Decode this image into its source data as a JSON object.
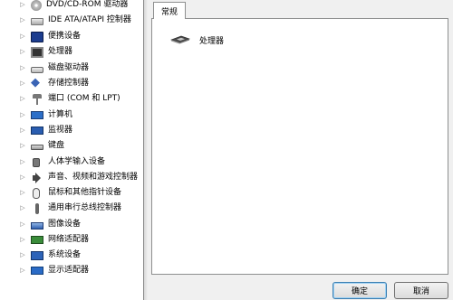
{
  "device_tree": {
    "items": [
      {
        "label": "DVD/CD-ROM 驱动器",
        "icon": "disc-drive-icon"
      },
      {
        "label": "IDE ATA/ATAPI 控制器",
        "icon": "ide-controller-icon"
      },
      {
        "label": "便携设备",
        "icon": "portable-device-icon"
      },
      {
        "label": "处理器",
        "icon": "processor-icon"
      },
      {
        "label": "磁盘驱动器",
        "icon": "disk-drive-icon"
      },
      {
        "label": "存储控制器",
        "icon": "storage-controller-icon"
      },
      {
        "label": "端口 (COM 和 LPT)",
        "icon": "port-icon"
      },
      {
        "label": "计算机",
        "icon": "computer-icon"
      },
      {
        "label": "监视器",
        "icon": "monitor-icon"
      },
      {
        "label": "键盘",
        "icon": "keyboard-icon"
      },
      {
        "label": "人体学输入设备",
        "icon": "hid-icon"
      },
      {
        "label": "声音、视频和游戏控制器",
        "icon": "audio-icon"
      },
      {
        "label": "鼠标和其他指针设备",
        "icon": "mouse-icon"
      },
      {
        "label": "通用串行总线控制器",
        "icon": "usb-icon"
      },
      {
        "label": "图像设备",
        "icon": "imaging-device-icon"
      },
      {
        "label": "网络适配器",
        "icon": "network-adapter-icon"
      },
      {
        "label": "系统设备",
        "icon": "system-device-icon"
      },
      {
        "label": "显示适配器",
        "icon": "display-adapter-icon"
      }
    ],
    "expander_glyph": "▷"
  },
  "dialog": {
    "tab_label": "常规",
    "device_name": "处理器",
    "ok_label": "确定",
    "cancel_label": "取消"
  }
}
